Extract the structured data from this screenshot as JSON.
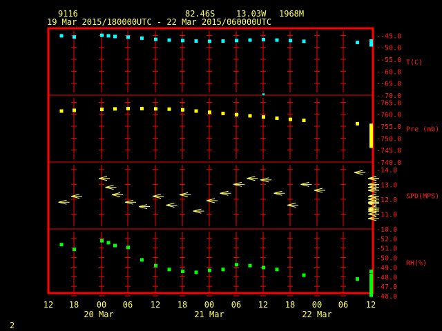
{
  "header": {
    "station": "9116",
    "lat": "82.46S",
    "lon": "13.03W",
    "elev": "1968M",
    "range": "19 Mar 2015/180000UTC - 22 Mar 2015/060000UTC"
  },
  "footer": {
    "page_number": "2"
  },
  "colors": {
    "frame": "#ff0000",
    "grid": "#ff0000",
    "text": "#ffff66",
    "label": "#ff2020",
    "temp": "#00ffff",
    "pres": "#ffff00",
    "wind": "#ffff66",
    "rh": "#00ff00"
  },
  "chart_data": {
    "type": "scatter",
    "x_ticks": [
      "12",
      "18",
      "00",
      "06",
      "12",
      "18",
      "00",
      "06",
      "12",
      "18",
      "00",
      "06",
      "12"
    ],
    "x_day_labels": [
      "20 Mar",
      "21 Mar",
      "22 Mar"
    ],
    "panels": [
      {
        "key": "temp",
        "label": "T(C)",
        "ylim": [
          -70,
          -42
        ],
        "ticks": [
          "-45.0",
          "-50.0",
          "-55.0",
          "-60.0",
          "-65.0",
          "-70.0"
        ],
        "tick_vals": [
          -45,
          -50,
          -55,
          -60,
          -65,
          -70
        ],
        "points": [
          [
            18,
            -45
          ],
          [
            19,
            -45.5
          ],
          [
            21,
            -44.8
          ],
          [
            21.5,
            -45
          ],
          [
            22,
            -45.3
          ],
          [
            23,
            -45.6
          ],
          [
            24,
            -46
          ],
          [
            25,
            -46.5
          ],
          [
            26,
            -46.8
          ],
          [
            27,
            -47
          ],
          [
            28,
            -47.2
          ],
          [
            29,
            -47.3
          ],
          [
            30,
            -47.2
          ],
          [
            31,
            -47
          ],
          [
            32,
            -46.8
          ],
          [
            33,
            -46.6
          ],
          [
            34,
            -46.8
          ],
          [
            35,
            -47
          ],
          [
            36,
            -47.3
          ],
          [
            40,
            -47.8
          ],
          [
            41,
            -48.2
          ],
          [
            42,
            -48.6
          ],
          [
            43,
            -48.8
          ],
          [
            44,
            -48.8
          ],
          [
            45,
            -48.6
          ],
          [
            46,
            -48.2
          ],
          [
            47,
            -47.9
          ],
          [
            48,
            -47.6
          ],
          [
            49,
            -47.3
          ],
          [
            51,
            -47.2
          ],
          [
            57,
            -47.8
          ]
        ],
        "outliers": [
          [
            33,
            -69.5
          ]
        ]
      },
      {
        "key": "pres",
        "label": "Pre (mb)",
        "ylim": [
          740,
          768
        ],
        "ticks": [
          "765.0",
          "760.0",
          "755.0",
          "750.0",
          "745.0",
          "740.0"
        ],
        "tick_vals": [
          765,
          760,
          755,
          750,
          745,
          740
        ],
        "points": [
          [
            18,
            761.5
          ],
          [
            19,
            761.8
          ],
          [
            21,
            762.2
          ],
          [
            22,
            762.4
          ],
          [
            23,
            762.5
          ],
          [
            24,
            762.5
          ],
          [
            25,
            762.4
          ],
          [
            26,
            762.3
          ],
          [
            27,
            762
          ],
          [
            28,
            761.5
          ],
          [
            29,
            761
          ],
          [
            30,
            760.5
          ],
          [
            31,
            760
          ],
          [
            32,
            759.5
          ],
          [
            33,
            759
          ],
          [
            34,
            758.5
          ],
          [
            35,
            758
          ],
          [
            36,
            757.6
          ],
          [
            40,
            756.2
          ],
          [
            41,
            755.5
          ],
          [
            42,
            754.8
          ],
          [
            43,
            754
          ],
          [
            44,
            753.2
          ],
          [
            45,
            752.3
          ],
          [
            46,
            751.5
          ],
          [
            47,
            750.7
          ],
          [
            48,
            750
          ],
          [
            49,
            749.4
          ],
          [
            50,
            748.8
          ],
          [
            52,
            747.8
          ],
          [
            58,
            746.8
          ]
        ]
      },
      {
        "key": "wind",
        "label": "SPD(MPS)",
        "ylim": [
          10,
          14.5
        ],
        "ticks": [
          "14.0",
          "13.0",
          "12.0",
          "11.0",
          "10.0"
        ],
        "tick_vals": [
          14,
          13,
          12,
          11,
          10
        ],
        "points": [
          [
            18,
            11.8
          ],
          [
            19,
            12.2
          ],
          [
            21,
            13.4
          ],
          [
            21.5,
            12.8
          ],
          [
            22,
            12.3
          ],
          [
            23,
            11.8
          ],
          [
            24,
            11.5
          ],
          [
            25,
            12.2
          ],
          [
            26,
            11.6
          ],
          [
            27,
            12.3
          ],
          [
            28,
            11.2
          ],
          [
            29,
            11.9
          ],
          [
            30,
            12.4
          ],
          [
            31,
            13.0
          ],
          [
            32,
            13.4
          ],
          [
            33,
            13.3
          ],
          [
            34,
            12.4
          ],
          [
            35,
            11.6
          ],
          [
            36,
            13
          ],
          [
            37,
            12.6
          ],
          [
            40,
            13.8
          ],
          [
            41,
            13.4
          ],
          [
            42,
            12.8
          ],
          [
            43,
            12.0
          ],
          [
            44,
            11.4
          ],
          [
            45,
            11.8
          ],
          [
            46,
            12.6
          ],
          [
            47,
            11.2
          ],
          [
            48,
            13.0
          ],
          [
            49,
            13.4
          ],
          [
            50,
            11.0
          ],
          [
            51,
            11.8
          ],
          [
            52,
            10.7
          ],
          [
            53,
            11.3
          ],
          [
            55,
            12.2
          ],
          [
            59,
            11.7
          ]
        ]
      },
      {
        "key": "rh",
        "label": "RH(%)",
        "ylim": [
          46,
          53
        ],
        "ticks": [
          "52.0",
          "51.0",
          "50.0",
          "49.0",
          "48.0",
          "47.0",
          "46.0"
        ],
        "tick_vals": [
          52,
          51,
          50,
          49,
          48,
          47,
          46
        ],
        "points": [
          [
            18,
            51.4
          ],
          [
            19,
            50.9
          ],
          [
            21,
            51.8
          ],
          [
            21.5,
            51.6
          ],
          [
            22,
            51.3
          ],
          [
            23,
            51.1
          ],
          [
            24,
            49.8
          ],
          [
            25,
            49.2
          ],
          [
            26,
            48.8
          ],
          [
            27,
            48.6
          ],
          [
            28,
            48.5
          ],
          [
            29,
            48.7
          ],
          [
            30,
            48.8
          ],
          [
            31,
            49.3
          ],
          [
            32,
            49.2
          ],
          [
            33,
            49
          ],
          [
            34,
            48.8
          ],
          [
            36,
            48.2
          ],
          [
            40,
            47.8
          ],
          [
            41,
            47.4
          ],
          [
            42,
            47.1
          ],
          [
            43,
            46.8
          ],
          [
            44,
            46.5
          ],
          [
            45,
            46.3
          ],
          [
            46,
            46.2
          ],
          [
            47,
            46.1
          ],
          [
            48,
            46.6
          ],
          [
            49,
            46.9
          ],
          [
            50,
            47.2
          ],
          [
            51,
            47.4
          ],
          [
            52,
            47.7
          ],
          [
            53,
            48
          ],
          [
            55,
            48.2
          ],
          [
            59,
            48.6
          ]
        ]
      }
    ]
  }
}
